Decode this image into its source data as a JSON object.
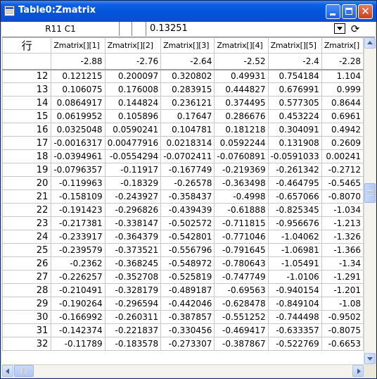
{
  "window": {
    "title": "Table0:Zmatrix"
  },
  "cellbar": {
    "ref": "R11 C1",
    "value": "0.13251"
  },
  "grid": {
    "corner_label": "行",
    "columns": [
      "Zmatrix[][1]",
      "Zmatrix[][2]",
      "Zmatrix[][3]",
      "Zmatrix[][4]",
      "Zmatrix[][5]",
      "Zmatrix[]"
    ],
    "x_values": [
      "-2.88",
      "-2.76",
      "-2.64",
      "-2.52",
      "-2.4",
      "-2.28"
    ],
    "rows": [
      {
        "n": "12",
        "v": [
          "0.121215",
          "0.200097",
          "0.320802",
          "0.49931",
          "0.754184",
          "1.104"
        ]
      },
      {
        "n": "13",
        "v": [
          "0.106075",
          "0.176008",
          "0.283915",
          "0.444827",
          "0.676991",
          "0.999"
        ]
      },
      {
        "n": "14",
        "v": [
          "0.0864917",
          "0.144824",
          "0.236121",
          "0.374495",
          "0.577305",
          "0.8644"
        ]
      },
      {
        "n": "15",
        "v": [
          "0.0619952",
          "0.105896",
          "0.17647",
          "0.286676",
          "0.453224",
          "0.6961"
        ]
      },
      {
        "n": "16",
        "v": [
          "0.0325048",
          "0.0590241",
          "0.104781",
          "0.181218",
          "0.304091",
          "0.4942"
        ]
      },
      {
        "n": "17",
        "v": [
          "-0.0016317",
          "0.00477916",
          "0.0218314",
          "0.0592244",
          "0.131908",
          "0.2609"
        ]
      },
      {
        "n": "18",
        "v": [
          "-0.0394961",
          "-0.0554294",
          "-0.0702411",
          "-0.0760891",
          "-0.0591033",
          "0.00241"
        ]
      },
      {
        "n": "19",
        "v": [
          "-0.0796357",
          "-0.11917",
          "-0.167749",
          "-0.219369",
          "-0.261342",
          "-0.2712"
        ]
      },
      {
        "n": "20",
        "v": [
          "-0.119963",
          "-0.18329",
          "-0.26578",
          "-0.363498",
          "-0.464795",
          "-0.5465"
        ]
      },
      {
        "n": "21",
        "v": [
          "-0.158109",
          "-0.243927",
          "-0.358437",
          "-0.4998",
          "-0.657066",
          "-0.8070"
        ]
      },
      {
        "n": "22",
        "v": [
          "-0.191423",
          "-0.296826",
          "-0.439439",
          "-0.61888",
          "-0.825345",
          "-1.034"
        ]
      },
      {
        "n": "23",
        "v": [
          "-0.217381",
          "-0.338147",
          "-0.502572",
          "-0.711815",
          "-0.956676",
          "-1.213"
        ]
      },
      {
        "n": "24",
        "v": [
          "-0.233917",
          "-0.364379",
          "-0.542801",
          "-0.771046",
          "-1.04062",
          "-1.326"
        ]
      },
      {
        "n": "25",
        "v": [
          "-0.239579",
          "-0.373521",
          "-0.556796",
          "-0.791645",
          "-1.06981",
          "-1.366"
        ]
      },
      {
        "n": "26",
        "v": [
          "-0.2362",
          "-0.368245",
          "-0.548972",
          "-0.780643",
          "-1.05491",
          "-1.34"
        ]
      },
      {
        "n": "27",
        "v": [
          "-0.226257",
          "-0.352708",
          "-0.525819",
          "-0.747749",
          "-1.0106",
          "-1.291"
        ]
      },
      {
        "n": "28",
        "v": [
          "-0.210491",
          "-0.328179",
          "-0.489187",
          "-0.69563",
          "-0.940154",
          "-1.201"
        ]
      },
      {
        "n": "29",
        "v": [
          "-0.190264",
          "-0.296594",
          "-0.442046",
          "-0.628478",
          "-0.849104",
          "-1.08"
        ]
      },
      {
        "n": "30",
        "v": [
          "-0.166992",
          "-0.260311",
          "-0.387857",
          "-0.551252",
          "-0.744498",
          "-0.9502"
        ]
      },
      {
        "n": "31",
        "v": [
          "-0.142374",
          "-0.221837",
          "-0.330456",
          "-0.469417",
          "-0.633357",
          "-0.8075"
        ]
      },
      {
        "n": "32",
        "v": [
          "-0.11789",
          "-0.183578",
          "-0.273307",
          "-0.387867",
          "-0.522769",
          "-0.6653"
        ]
      }
    ]
  },
  "colors": {
    "titlebar": "#0453d8",
    "grid_line": "#c8c8c8",
    "window_bg": "#ece9d8"
  },
  "icons": [
    "table-window-icon",
    "minimize-icon",
    "maximize-icon",
    "close-icon",
    "dropdown-arrow-icon",
    "refresh-icon"
  ]
}
